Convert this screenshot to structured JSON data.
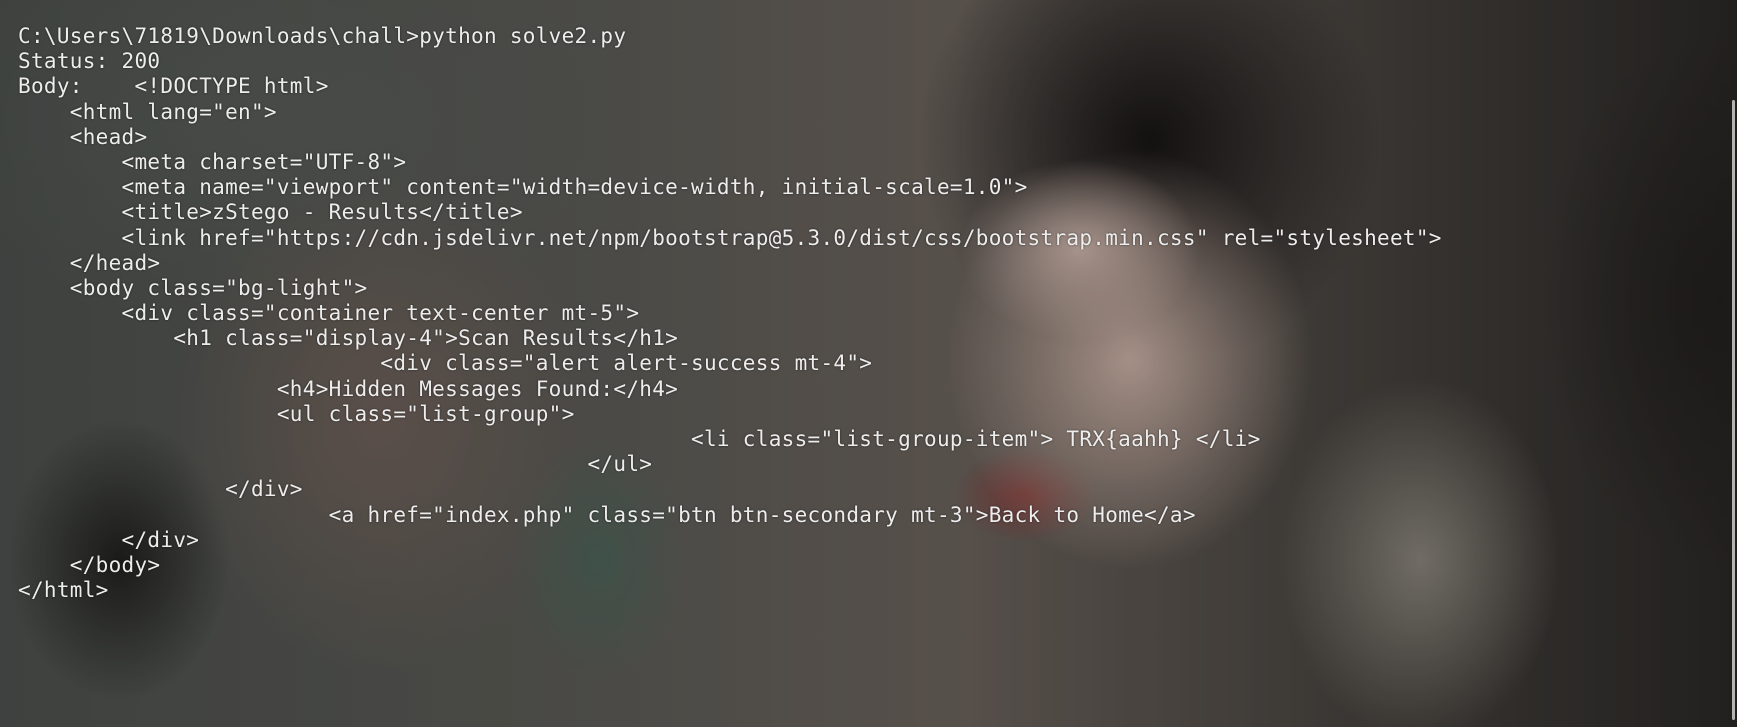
{
  "terminal": {
    "lines": [
      "C:\\Users\\71819\\Downloads\\chall>python solve2.py",
      "Status: 200",
      "Body:    <!DOCTYPE html>",
      "    <html lang=\"en\">",
      "    <head>",
      "        <meta charset=\"UTF-8\">",
      "        <meta name=\"viewport\" content=\"width=device-width, initial-scale=1.0\">",
      "        <title>zStego - Results</title>",
      "        <link href=\"https://cdn.jsdelivr.net/npm/bootstrap@5.3.0/dist/css/bootstrap.min.css\" rel=\"stylesheet\">",
      "    </head>",
      "    <body class=\"bg-light\">",
      "        <div class=\"container text-center mt-5\">",
      "            <h1 class=\"display-4\">Scan Results</h1>",
      "                            <div class=\"alert alert-success mt-4\">",
      "                    <h4>Hidden Messages Found:</h4>",
      "                    <ul class=\"list-group\">",
      "                                                    <li class=\"list-group-item\"> TRX{aahh} </li>",
      "                                            </ul>",
      "                </div>",
      "                        <a href=\"index.php\" class=\"btn btn-secondary mt-3\">Back to Home</a>",
      "        </div>",
      "    </body>",
      "</html>"
    ]
  }
}
